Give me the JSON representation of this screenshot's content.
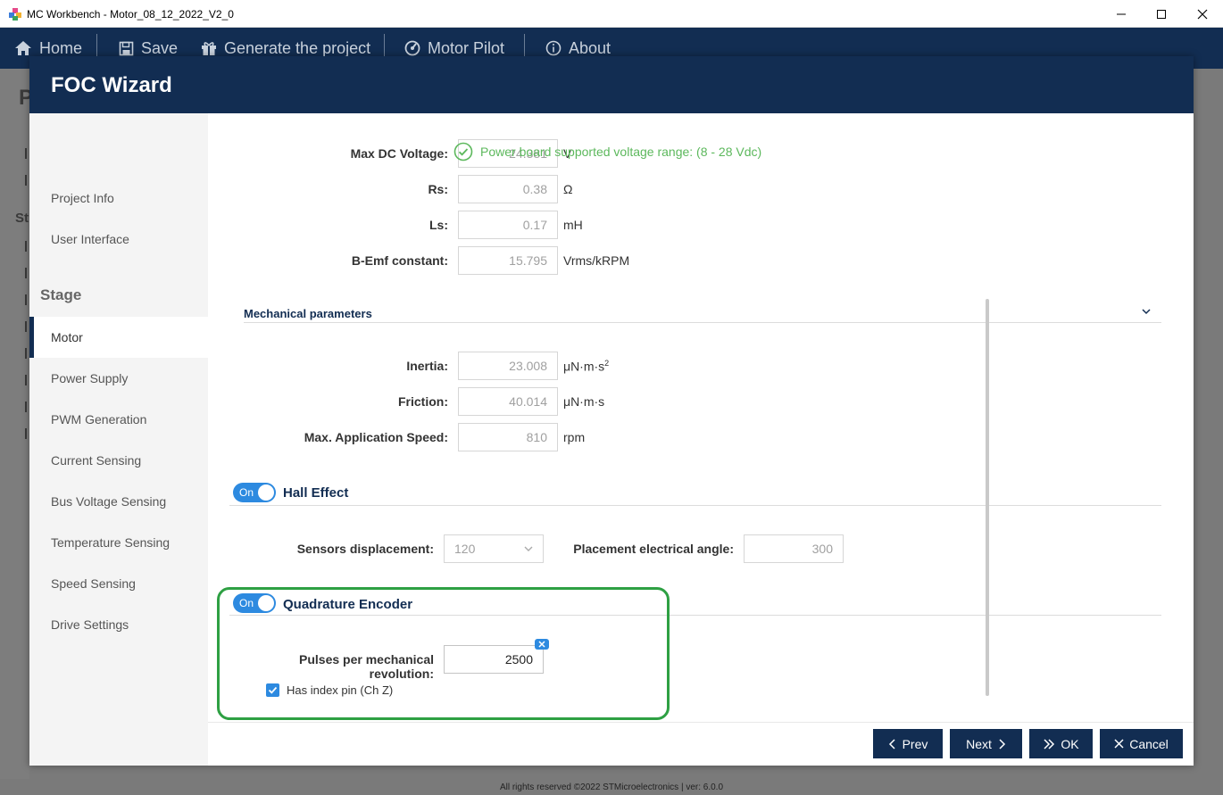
{
  "window": {
    "title": "MC Workbench - Motor_08_12_2022_V2_0"
  },
  "menu": {
    "home": "Home",
    "save": "Save",
    "generate": "Generate the project",
    "motor_pilot": "Motor Pilot",
    "about": "About"
  },
  "background": {
    "letter_p": "P",
    "letter_st": "St"
  },
  "footer_text": "All rights reserved ©2022 STMicroelectronics | ver: 6.0.0",
  "dialog": {
    "title": "FOC Wizard",
    "sidebar": {
      "items_top": [
        "Project Info",
        "User Interface"
      ],
      "section": "Stage",
      "items": [
        "Motor",
        "Power Supply",
        "PWM Generation",
        "Current Sensing",
        "Bus Voltage Sensing",
        "Temperature Sensing",
        "Speed Sensing",
        "Drive Settings"
      ],
      "active": "Motor"
    },
    "electrical": {
      "max_dc_voltage": {
        "label": "Max DC Voltage:",
        "value": "24.381",
        "unit": "V"
      },
      "rs": {
        "label": "Rs:",
        "value": "0.38",
        "unit": "Ω"
      },
      "ls": {
        "label": "Ls:",
        "value": "0.17",
        "unit": "mH"
      },
      "bemf": {
        "label": "B-Emf constant:",
        "value": "15.795",
        "unit": "Vrms/kRPM"
      },
      "voltage_info": "Power board supported voltage range: (8 - 28 Vdc)"
    },
    "mechanical": {
      "title": "Mechanical parameters",
      "inertia": {
        "label": "Inertia:",
        "value": "23.008",
        "unit": "μN·m·s",
        "unit_sup": "2"
      },
      "friction": {
        "label": "Friction:",
        "value": "40.014",
        "unit": "μN·m·s"
      },
      "max_speed": {
        "label": "Max. Application Speed:",
        "value": "810",
        "unit": "rpm"
      }
    },
    "hall": {
      "toggle": "On",
      "title": "Hall Effect",
      "displacement_label": "Sensors displacement:",
      "displacement_value": "120",
      "angle_label": "Placement electrical angle:",
      "angle_value": "300"
    },
    "encoder": {
      "toggle": "On",
      "title": "Quadrature Encoder",
      "pulses_label": "Pulses per mechanical revolution:",
      "pulses_value": "2500",
      "index_pin_label": "Has index pin (Ch Z)",
      "index_pin_checked": true
    },
    "buttons": {
      "prev": "Prev",
      "next": "Next",
      "ok": "OK",
      "cancel": "Cancel"
    }
  },
  "colors": {
    "navy": "#122d52",
    "accent_blue": "#2d8ae0",
    "success_green": "#5cb85c",
    "highlight_green": "#2ea043"
  }
}
